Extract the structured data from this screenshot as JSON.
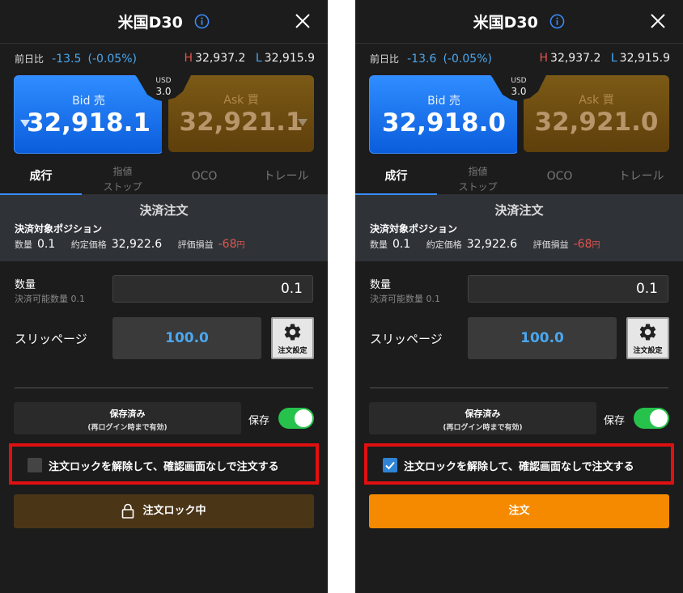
{
  "colors": {
    "bid": "#1a72f0",
    "ask": "#6e4e13",
    "accent": "#3a8dff",
    "negative": "#e0554f",
    "order_button": "#f58a00",
    "toggle_on": "#27c24c",
    "highlight_frame": "#e01010"
  },
  "left": {
    "title": "米国D30",
    "prev_label": "前日比",
    "prev_change": "-13.5",
    "prev_change_pct": "(-0.05%)",
    "high_label": "H",
    "high_value": "32,937.2",
    "low_label": "L",
    "low_value": "32,915.9",
    "bid_label": "Bid 売",
    "bid_price": "32,918.1",
    "ask_label": "Ask 買",
    "ask_price": "32,921.1",
    "spread_unit": "USD",
    "spread_value": "3.0",
    "tab_market": "成行",
    "tab_stop_1": "指値",
    "tab_stop_2": "ストップ",
    "tab_oco": "OCO",
    "tab_trail": "トレール",
    "section_title": "決済注文",
    "position_title": "決済対象ポジション",
    "qty_label": "数量",
    "qty_value": "0.1",
    "price_label": "約定価格",
    "price_value": "32,922.6",
    "pl_label": "評価損益",
    "pl_value": "-68",
    "pl_unit": "円",
    "quantity_label": "数量",
    "quantity_sub": "決済可能数量 0.1",
    "quantity_input": "0.1",
    "slippage_label": "スリッページ",
    "slippage_value": "100.0",
    "settings_label": "注文設定",
    "saved_line1": "保存済み",
    "saved_line2": "(再ログイン時まで有効)",
    "save_label": "保存",
    "lock_text": "注文ロックを解除して、確認画面なしで注文する",
    "locked_button": "注文ロック中"
  },
  "right": {
    "title": "米国D30",
    "prev_label": "前日比",
    "prev_change": "-13.6",
    "prev_change_pct": "(-0.05%)",
    "high_label": "H",
    "high_value": "32,937.2",
    "low_label": "L",
    "low_value": "32,915.9",
    "bid_label": "Bid 売",
    "bid_price": "32,918.0",
    "ask_label": "Ask 買",
    "ask_price": "32,921.0",
    "spread_unit": "USD",
    "spread_value": "3.0",
    "tab_market": "成行",
    "tab_stop_1": "指値",
    "tab_stop_2": "ストップ",
    "tab_oco": "OCO",
    "tab_trail": "トレール",
    "section_title": "決済注文",
    "position_title": "決済対象ポジション",
    "qty_label": "数量",
    "qty_value": "0.1",
    "price_label": "約定価格",
    "price_value": "32,922.6",
    "pl_label": "評価損益",
    "pl_value": "-68",
    "pl_unit": "円",
    "quantity_label": "数量",
    "quantity_sub": "決済可能数量 0.1",
    "quantity_input": "0.1",
    "slippage_label": "スリッページ",
    "slippage_value": "100.0",
    "settings_label": "注文設定",
    "saved_line1": "保存済み",
    "saved_line2": "(再ログイン時まで有効)",
    "save_label": "保存",
    "lock_text": "注文ロックを解除して、確認画面なしで注文する",
    "order_button": "注文"
  }
}
